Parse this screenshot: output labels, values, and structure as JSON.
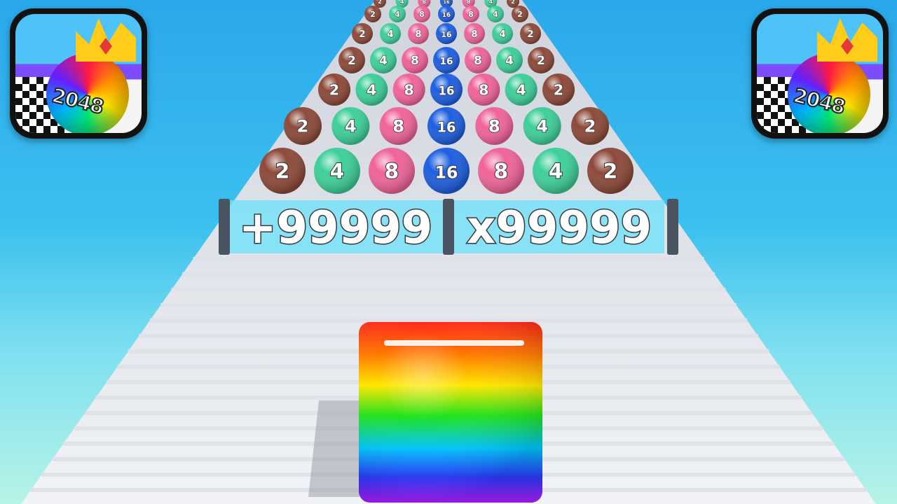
{
  "app_icon": {
    "label": "2048"
  },
  "gates": {
    "left_text": "+99999",
    "right_text": "x99999"
  },
  "balls": {
    "rows": [
      [
        "2",
        "4",
        "8",
        "16",
        "8",
        "4",
        "2"
      ],
      [
        "2",
        "4",
        "8",
        "16",
        "8",
        "4",
        "2"
      ],
      [
        "2",
        "4",
        "8",
        "16",
        "8",
        "4",
        "2"
      ],
      [
        "2",
        "4",
        "8",
        "16",
        "8",
        "4",
        "2"
      ],
      [
        "2",
        "4",
        "8",
        "16",
        "8",
        "4",
        "2"
      ],
      [
        "2",
        "4",
        "8",
        "16",
        "8",
        "4",
        "2"
      ],
      [
        "2",
        "4",
        "8",
        "16",
        "8",
        "4",
        "2"
      ]
    ],
    "colors": {
      "2": "#8d4a3a",
      "4": "#3ecf9a",
      "8": "#f0649a",
      "16": "#1e5fe0"
    }
  },
  "player_cube": {
    "color": "rainbow"
  }
}
